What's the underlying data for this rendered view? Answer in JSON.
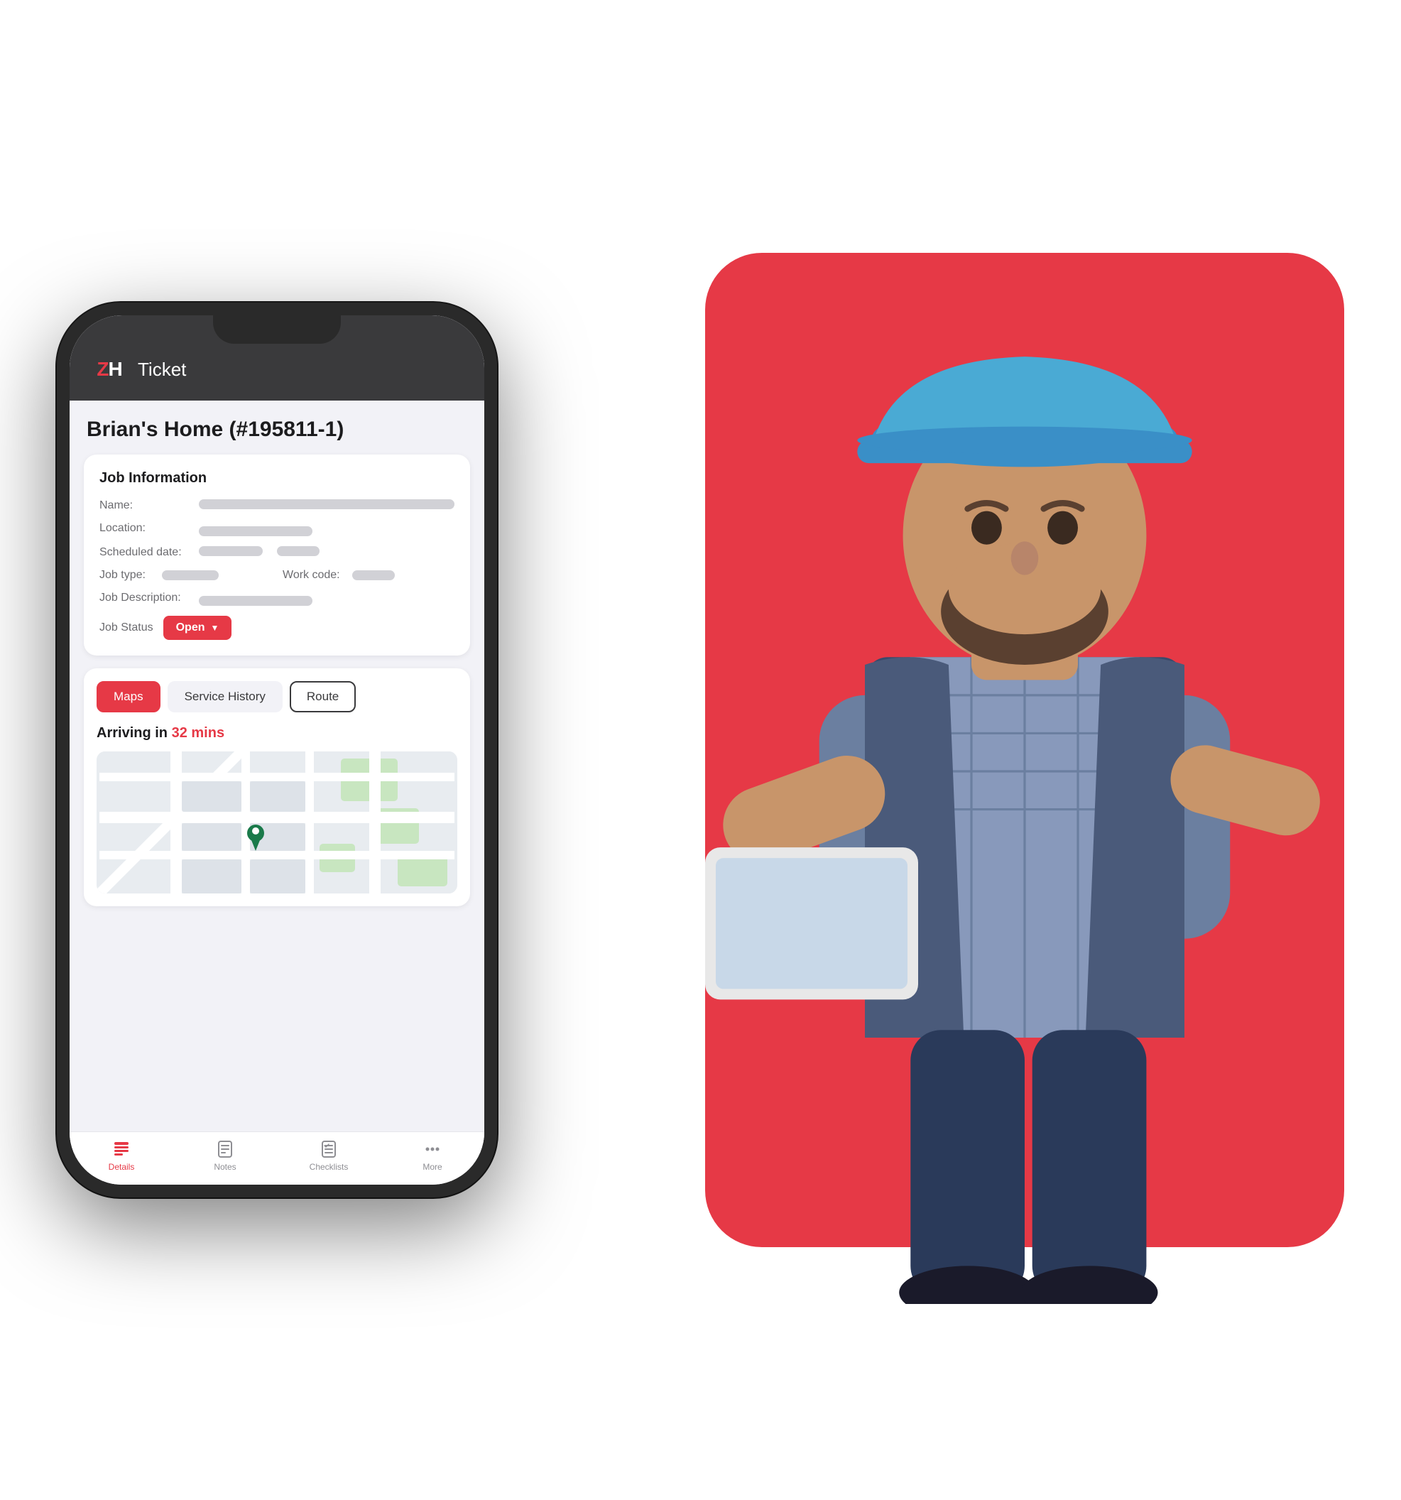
{
  "app": {
    "logo": "ZH",
    "logo_accent": "Z",
    "title": "Ticket"
  },
  "job": {
    "title": "Brian's Home (#195811-1)",
    "card_title": "Job Information",
    "fields": {
      "name_label": "Name:",
      "location_label": "Location:",
      "scheduled_date_label": "Scheduled date:",
      "job_type_label": "Job type:",
      "work_code_label": "Work code:",
      "job_description_label": "Job Description:",
      "job_status_label": "Job Status",
      "status_value": "Open"
    }
  },
  "tabs": {
    "maps": "Maps",
    "service_history": "Service History",
    "route": "Route"
  },
  "arrival": {
    "prefix": "Arriving in ",
    "time": "32 mins"
  },
  "bottom_nav": {
    "items": [
      {
        "label": "Details",
        "active": true
      },
      {
        "label": "Notes",
        "active": false
      },
      {
        "label": "Checklists",
        "active": false
      },
      {
        "label": "More",
        "active": false
      }
    ]
  }
}
